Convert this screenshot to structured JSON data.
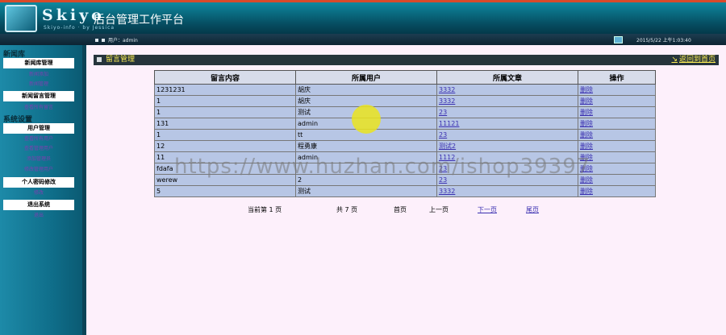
{
  "header": {
    "logo_text": "Skiyo",
    "logo_sub": "Skiyo-info · by Jessica",
    "platform_title": "后台管理工作平台"
  },
  "subbar": {
    "user_label": "用户：admin",
    "clock": "2015/5/22 上午1:03:40"
  },
  "sidebar": {
    "group1_title": "新闻库",
    "group1_head1": "新闻库管理",
    "group1_link1": "新闻添加",
    "group1_link2": "新闻管理",
    "group1_head2": "新闻留言管理",
    "group1_link3": "查看所有留言",
    "group2_title": "系统设置",
    "group2_head1": "用户管理",
    "group2_link1": "查看所有用户",
    "group2_link2": "查看管理用户",
    "group2_link3": "添加管理员",
    "group2_link4": "修改管理用户",
    "group2_head2": "个人密码修改",
    "group2_link5": "修改",
    "group2_head3": "退出系统",
    "group2_link6": "退出"
  },
  "main": {
    "section_title": "留言管理",
    "back_link": "返回到首页",
    "table": {
      "headers": [
        "留言内容",
        "所属用户",
        "所属文章",
        "操作"
      ],
      "rows": [
        [
          "1231231",
          "胡庆",
          "3332",
          "删除"
        ],
        [
          "1",
          "胡庆",
          "3332",
          "删除"
        ],
        [
          "1",
          "测试",
          "23",
          "删除"
        ],
        [
          "131",
          "admin",
          "11121",
          "删除"
        ],
        [
          "1",
          "tt",
          "23",
          "删除"
        ],
        [
          "12",
          "程勇康",
          "测试2",
          "删除"
        ],
        [
          "11",
          "admin",
          "1112",
          "删除"
        ],
        [
          "fdafa",
          "",
          "23",
          "删除"
        ],
        [
          "werew",
          "2",
          "23",
          "删除"
        ],
        [
          "5",
          "测试",
          "3332",
          "删除"
        ]
      ]
    },
    "pager": {
      "current": "当前第 1 页",
      "total": "共 7 页",
      "first": "首页",
      "prev": "上一页",
      "next": "下一页",
      "last": "尾页"
    }
  },
  "overlay": {
    "watermark": "https://www.huzhan.com/ishop39397"
  }
}
